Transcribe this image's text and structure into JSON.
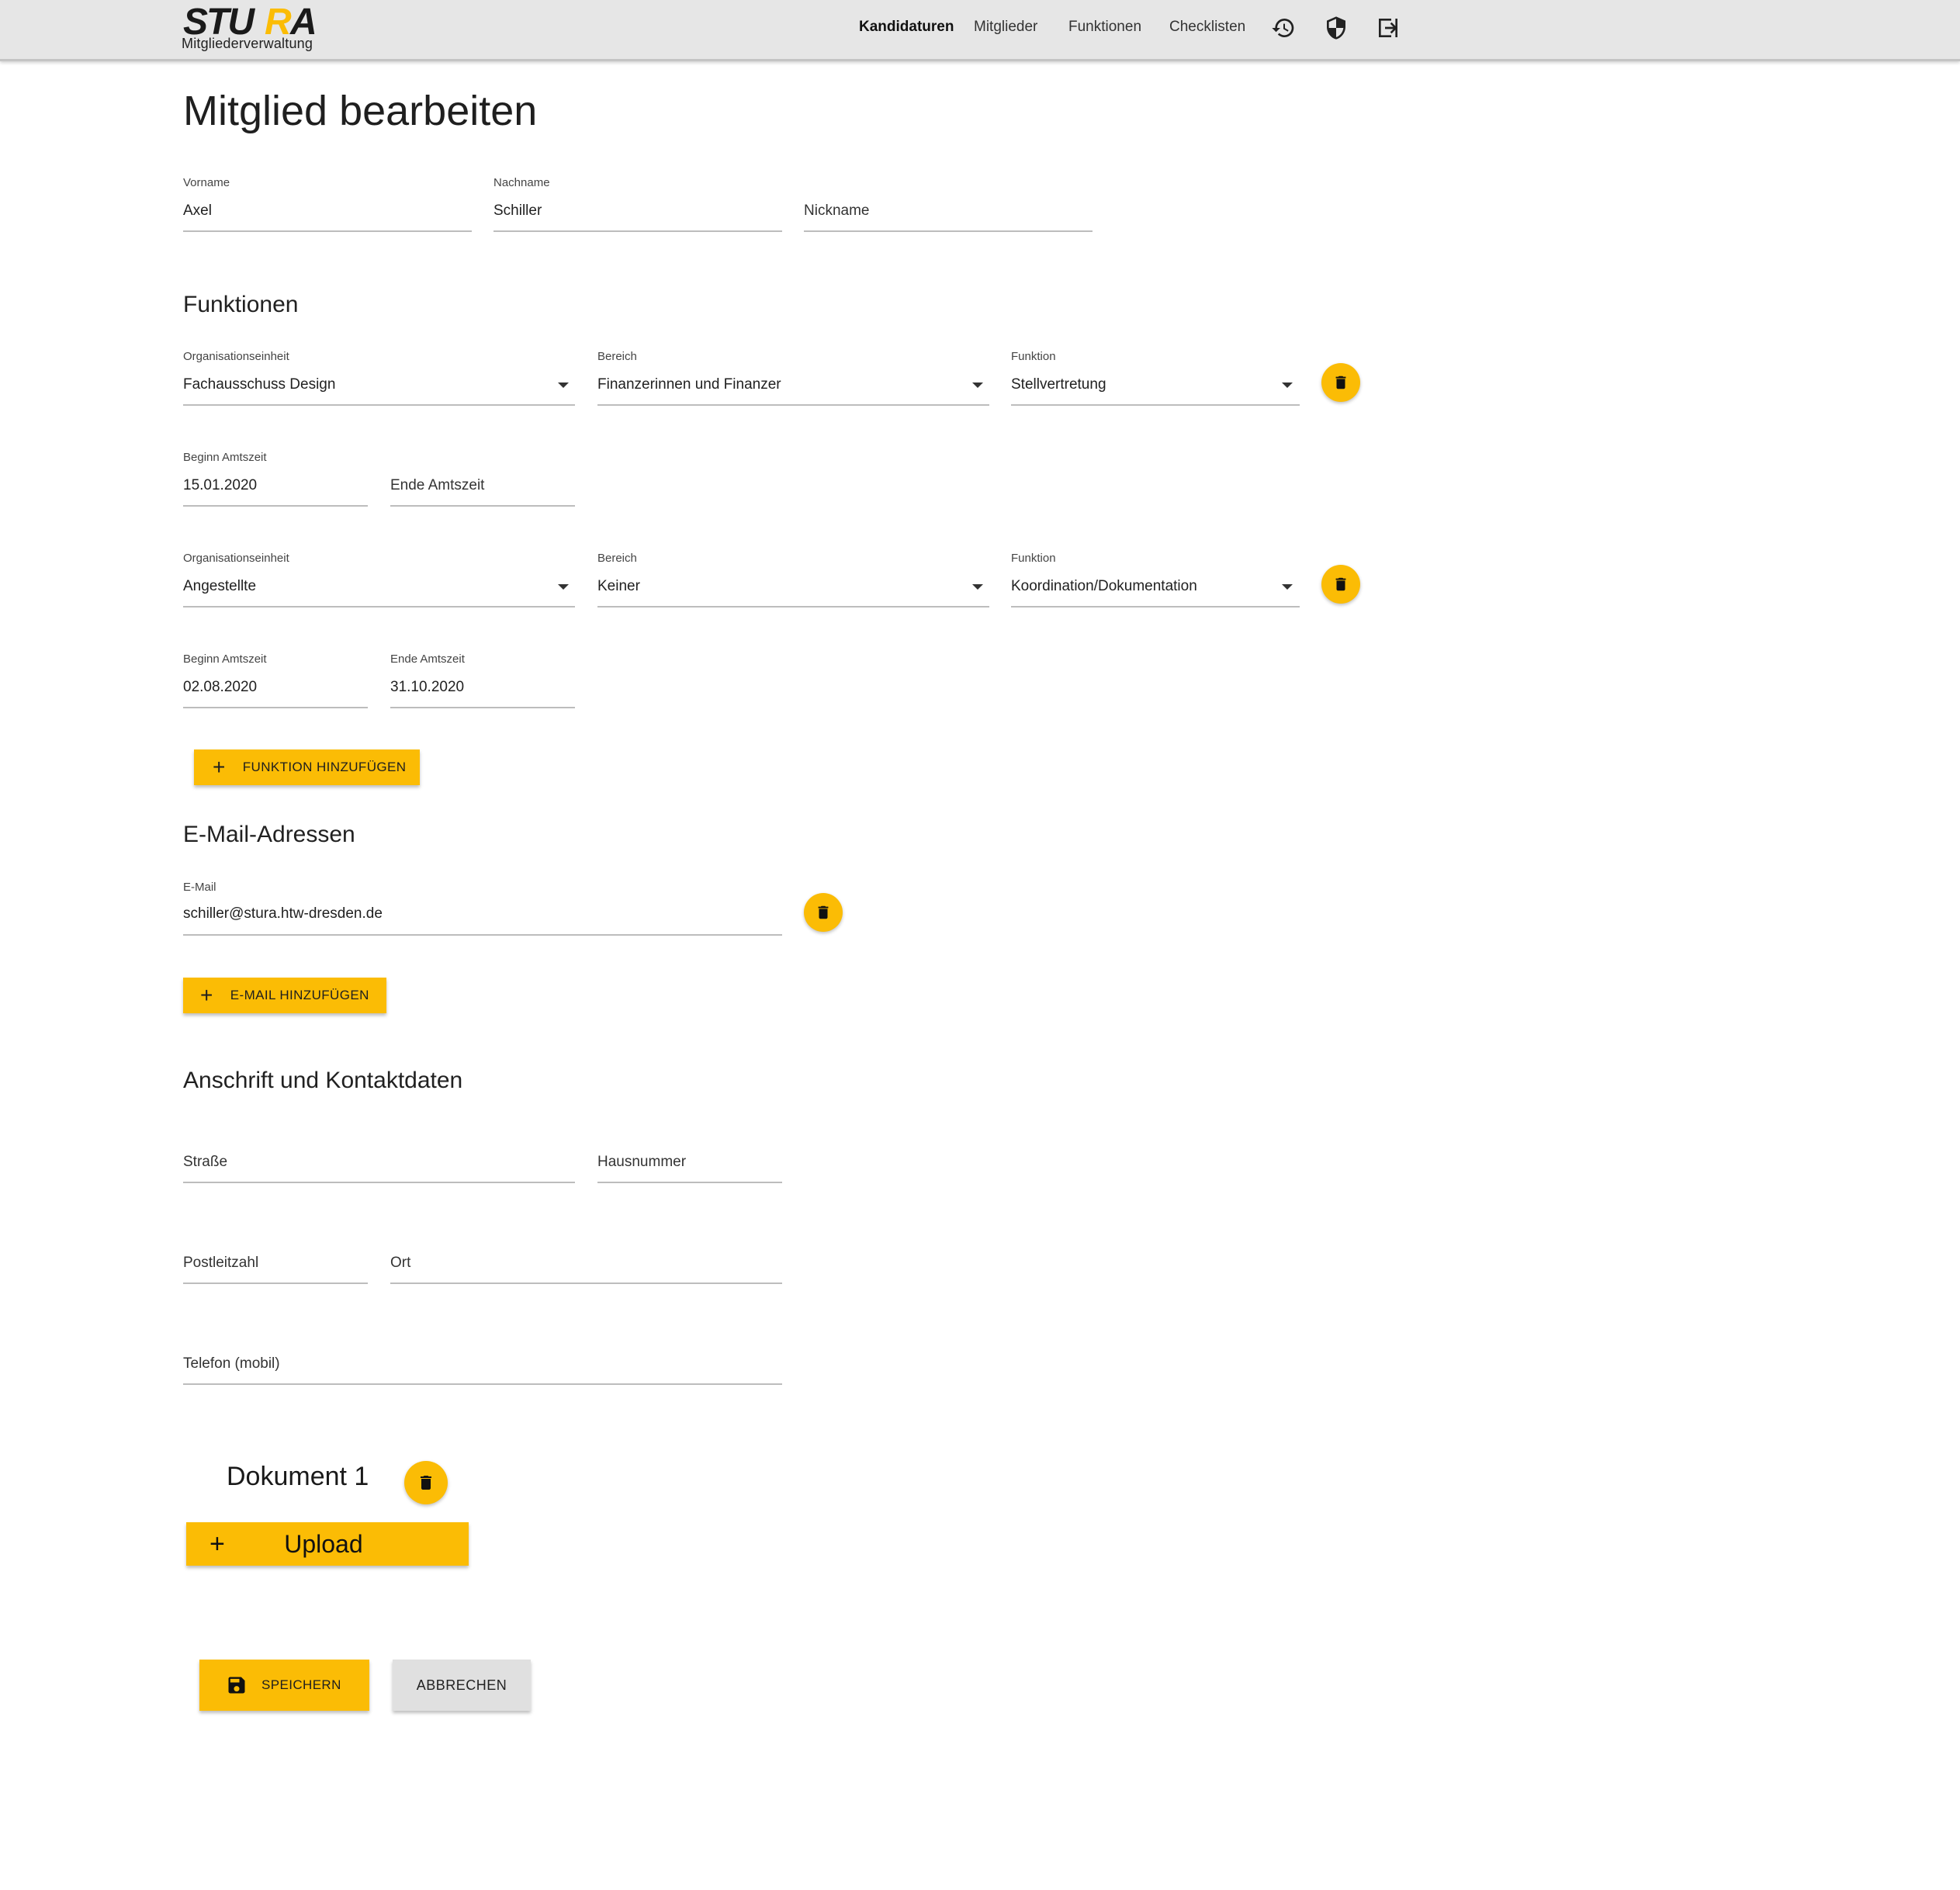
{
  "app": {
    "logo_text": "STURA",
    "subtitle": "Mitgliederverwaltung",
    "brand_color": "#fbbc05"
  },
  "nav": {
    "items": [
      "Kandidaturen",
      "Mitglieder",
      "Funktionen",
      "Checklisten"
    ],
    "active": "Kandidaturen",
    "icons": [
      "history-icon",
      "shield-icon",
      "logout-icon"
    ]
  },
  "page": {
    "title": "Mitglied bearbeiten"
  },
  "name": {
    "vorname_label": "Vorname",
    "vorname_value": "Axel",
    "nachname_label": "Nachname",
    "nachname_value": "Schiller",
    "nickname_placeholder": "Nickname"
  },
  "funktionen": {
    "heading": "Funktionen",
    "entries": [
      {
        "org_label": "Organisationseinheit",
        "org_value": "Fachausschuss Design",
        "bereich_label": "Bereich",
        "bereich_value": "Finanzerinnen und Finanzer",
        "funktion_label": "Funktion",
        "funktion_value": "Stellvertretung",
        "beginn_label": "Beginn Amtszeit",
        "beginn_value": "15.01.2020",
        "ende_placeholder": "Ende Amtszeit"
      },
      {
        "org_label": "Organisationseinheit",
        "org_value": "Angestellte",
        "bereich_label": "Bereich",
        "bereich_value": "Keiner",
        "funktion_label": "Funktion",
        "funktion_value": "Koordination/Dokumentation",
        "beginn_label": "Beginn Amtszeit",
        "beginn_value": "02.08.2020",
        "ende_label": "Ende Amtszeit",
        "ende_value": "31.10.2020"
      }
    ],
    "add_button": "FUNKTION HINZUFÜGEN"
  },
  "emails": {
    "heading": "E-Mail-Adressen",
    "label": "E-Mail",
    "value": "schiller@stura.htw-dresden.de",
    "add_button": "E-MAIL HINZUFÜGEN"
  },
  "kontakt": {
    "heading": "Anschrift und Kontaktdaten",
    "strasse": "Straße",
    "hausnummer": "Hausnummer",
    "plz": "Postleitzahl",
    "ort": "Ort",
    "telefon": "Telefon (mobil)"
  },
  "dokumente": {
    "title": "Dokument 1",
    "upload_button": "Upload"
  },
  "actions": {
    "save": "SPEICHERN",
    "cancel": "ABBRECHEN"
  }
}
